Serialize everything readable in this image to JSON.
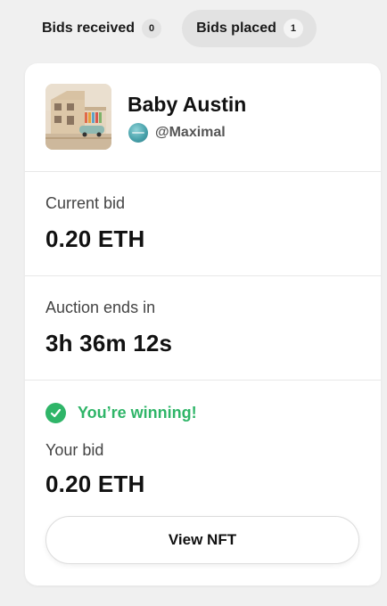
{
  "tabs": [
    {
      "label": "Bids received",
      "count": "0"
    },
    {
      "label": "Bids placed",
      "count": "1"
    }
  ],
  "nft": {
    "title": "Baby Austin",
    "creator": "@Maximal",
    "thumbnail_icon": "house-artwork"
  },
  "current_bid": {
    "label": "Current bid",
    "value": "0.20 ETH"
  },
  "auction": {
    "label": "Auction ends in",
    "value": "3h 36m 12s"
  },
  "status": {
    "text": "You’re winning!",
    "icon": "check-circle-icon",
    "color": "#2fb568"
  },
  "your_bid": {
    "label": "Your bid",
    "value": "0.20 ETH"
  },
  "actions": {
    "view_label": "View NFT"
  }
}
